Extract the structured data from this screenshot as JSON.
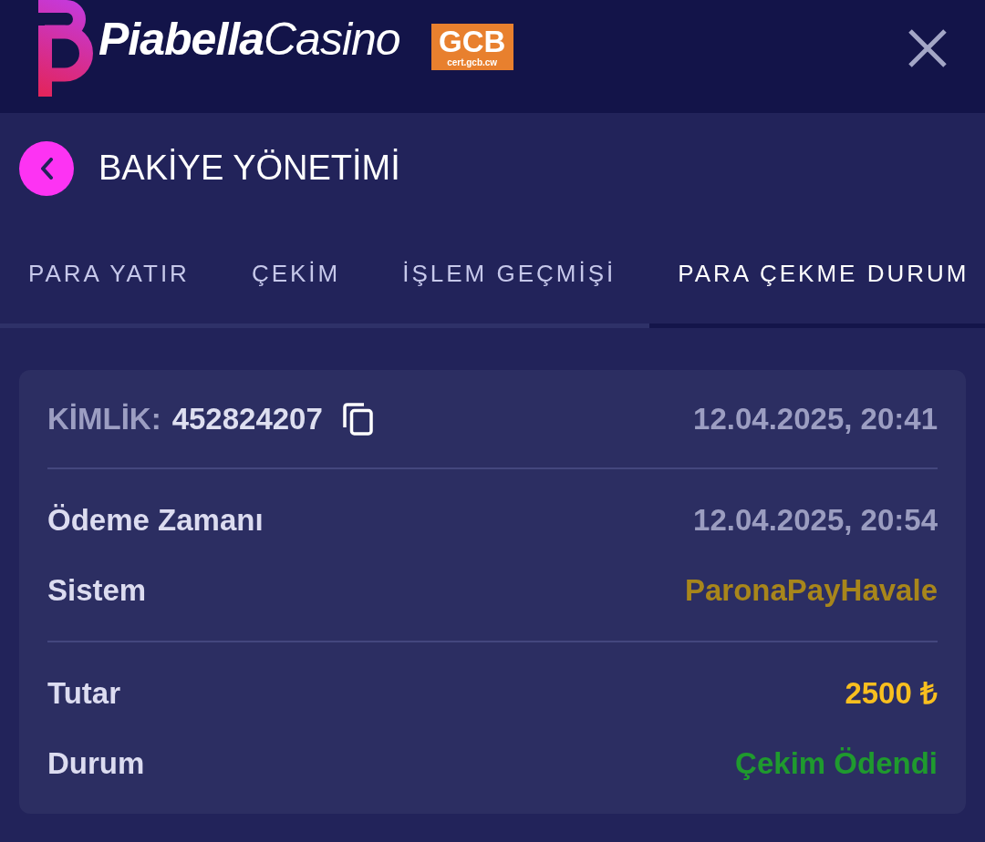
{
  "header": {
    "logo": {
      "name": "**Piabella**Casino"
    },
    "badge": {
      "title": "GCB",
      "subtitle": "cert.gcb.cw"
    }
  },
  "page": {
    "title": "BAKİYE YÖNETİMİ"
  },
  "tabs": [
    {
      "label": "PARA YATIR",
      "selected": false
    },
    {
      "label": "ÇEKİM",
      "selected": false
    },
    {
      "label": "İŞLEM GEÇMİŞİ",
      "selected": false
    },
    {
      "label": "PARA ÇEKME DURUM",
      "selected": true
    }
  ],
  "card": {
    "id_label": "KİMLİK:",
    "id_value": "452824207",
    "created": "12.04.2025, 20:41",
    "groups": [
      {
        "rows": [
          {
            "label": "Ödeme Zamanı",
            "value": "12.04.2025, 20:54",
            "color": "#9b9dc0"
          },
          {
            "label": "Sistem",
            "value": "ParonaPayHavale",
            "color": "#a8861b"
          }
        ]
      },
      {
        "rows": [
          {
            "label": "Tutar",
            "value": "2500 ₺",
            "color": "#f8bf1f"
          },
          {
            "label": "Durum",
            "value": "Çekim Ödendi",
            "color": "#1f9a2e"
          }
        ]
      }
    ]
  }
}
